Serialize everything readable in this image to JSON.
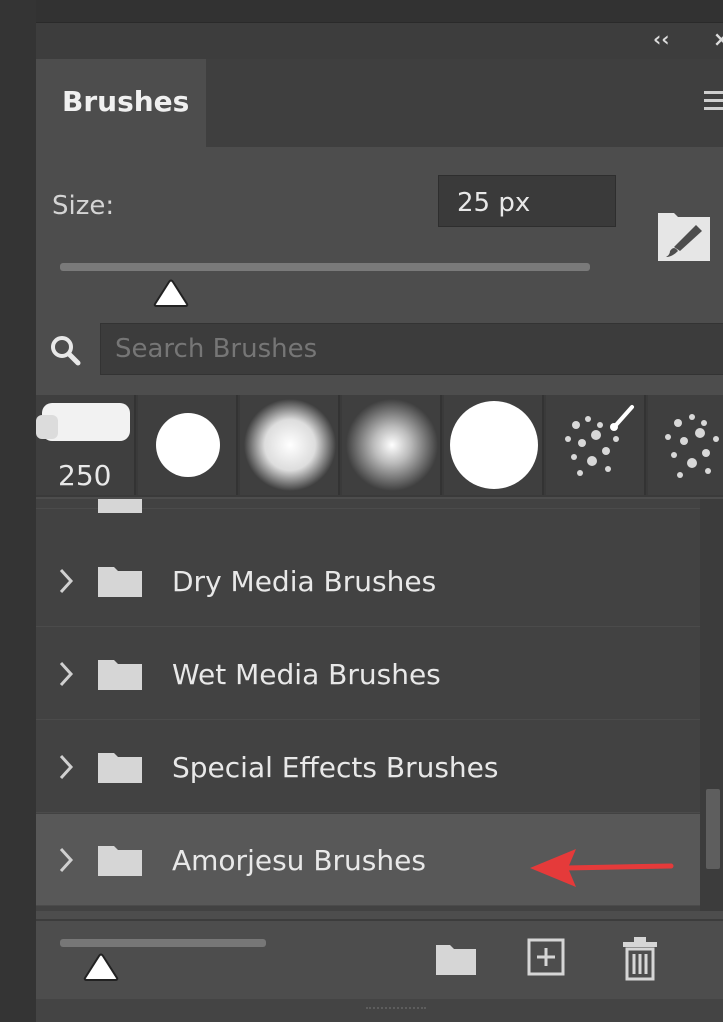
{
  "panel": {
    "title_controls": {
      "collapse": "‹‹",
      "close": "×"
    },
    "tab": {
      "label": "Brushes"
    },
    "size": {
      "label": "Size:",
      "value": "25 px",
      "slider_fraction": 0.21
    },
    "search": {
      "placeholder": "Search Brushes",
      "value": ""
    },
    "presets": [
      {
        "name": "preset-chalk",
        "label": "250"
      },
      {
        "name": "preset-hard-round"
      },
      {
        "name": "preset-soft-round"
      },
      {
        "name": "preset-soft-round-large"
      },
      {
        "name": "preset-hard-round-large"
      },
      {
        "name": "preset-kyle-texture"
      },
      {
        "name": "preset-kyle-texture-2"
      }
    ],
    "folders": [
      {
        "label": "Dry Media Brushes",
        "selected": false
      },
      {
        "label": "Wet Media Brushes",
        "selected": false
      },
      {
        "label": "Special Effects Brushes",
        "selected": false
      },
      {
        "label": "Amorjesu Brushes",
        "selected": true
      }
    ],
    "thumbnail_size_fraction": 0.2
  },
  "colors": {
    "panel_bg": "#4d4d4d",
    "list_bg": "#424242",
    "selected_row": "#585858",
    "annotation_arrow": "#e53a3a"
  },
  "icons": [
    "chevron-right-icon",
    "folder-icon",
    "search-icon",
    "brush-settings-icon",
    "new-group-icon",
    "new-brush-icon",
    "trash-icon",
    "panel-menu-icon"
  ]
}
